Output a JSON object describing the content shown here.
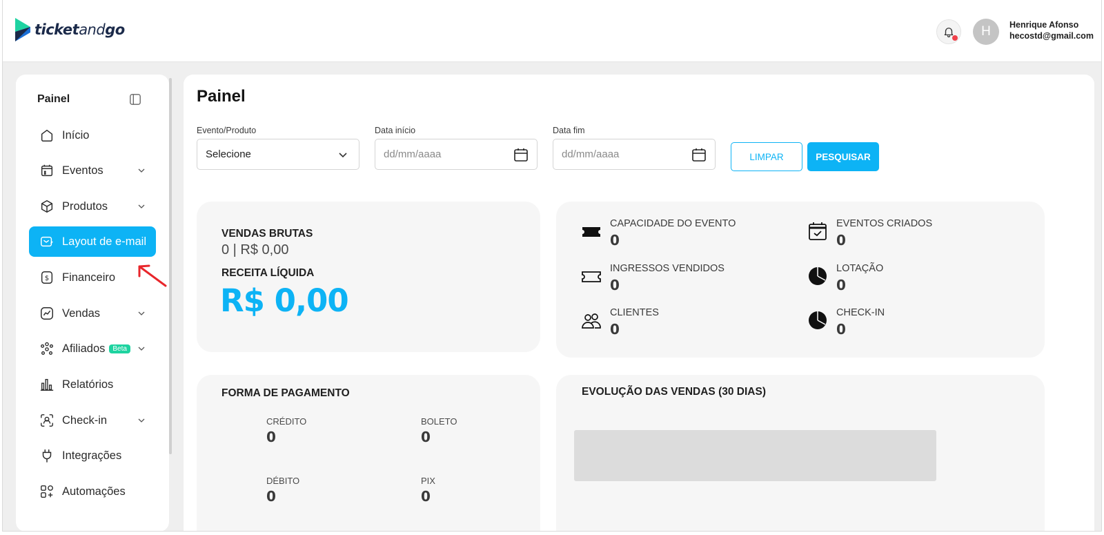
{
  "app": {
    "logo_left": "ticket",
    "logo_mid": "and",
    "logo_right": "go"
  },
  "user": {
    "name": "Henrique Afonso",
    "email": "hecostd@gmail.com",
    "avatar_letter": "H"
  },
  "sidebar": {
    "title": "Painel",
    "items": [
      {
        "label": "Início",
        "icon": "home-icon"
      },
      {
        "label": "Eventos",
        "icon": "calendar-icon"
      },
      {
        "label": "Produtos",
        "icon": "box-icon"
      },
      {
        "label": "Layout de e-mail",
        "icon": "email-layout-icon",
        "active": true
      },
      {
        "label": "Financeiro",
        "icon": "dollar-icon"
      },
      {
        "label": "Vendas",
        "icon": "trend-icon"
      },
      {
        "label": "Afiliados",
        "icon": "affiliates-icon",
        "badge": "Beta"
      },
      {
        "label": "Relatórios",
        "icon": "bar-chart-icon"
      },
      {
        "label": "Check-in",
        "icon": "scan-user-icon"
      },
      {
        "label": "Integrações",
        "icon": "plug-icon"
      },
      {
        "label": "Automações",
        "icon": "automation-icon"
      }
    ]
  },
  "main": {
    "title": "Painel",
    "filters": {
      "evento_label": "Evento/Produto",
      "evento_value": "Selecione",
      "inicio_label": "Data início",
      "inicio_placeholder": "dd/mm/aaaa",
      "fim_label": "Data fim",
      "fim_placeholder": "dd/mm/aaaa",
      "clear_label": "LIMPAR",
      "search_label": "PESQUISAR"
    },
    "sales": {
      "gross_label": "VENDAS BRUTAS",
      "gross_value": "0 | R$ 0,00",
      "net_label": "RECEITA LÍQUIDA",
      "net_value": "R$ 0,00"
    },
    "stats": {
      "capacidade_label": "CAPACIDADE DO EVENTO",
      "capacidade_value": "0",
      "criados_label": "EVENTOS CRIADOS",
      "criados_value": "0",
      "ingressos_label": "INGRESSOS VENDIDOS",
      "ingressos_value": "0",
      "lotacao_label": "LOTAÇÃO",
      "lotacao_value": "0",
      "clientes_label": "CLIENTES",
      "clientes_value": "0",
      "checkin_label": "CHECK-IN",
      "checkin_value": "0"
    },
    "payment": {
      "title": "FORMA DE PAGAMENTO",
      "credito_label": "CRÉDITO",
      "credito_value": "0",
      "boleto_label": "BOLETO",
      "boleto_value": "0",
      "debito_label": "DÉBITO",
      "debito_value": "0",
      "pix_label": "PIX",
      "pix_value": "0"
    },
    "evolution": {
      "title": "EVOLUÇÃO DAS VENDAS (30 DIAS)"
    }
  },
  "colors": {
    "accent": "#0db3f5",
    "beta": "#1ed3a0",
    "annotation": "#e8262b"
  }
}
